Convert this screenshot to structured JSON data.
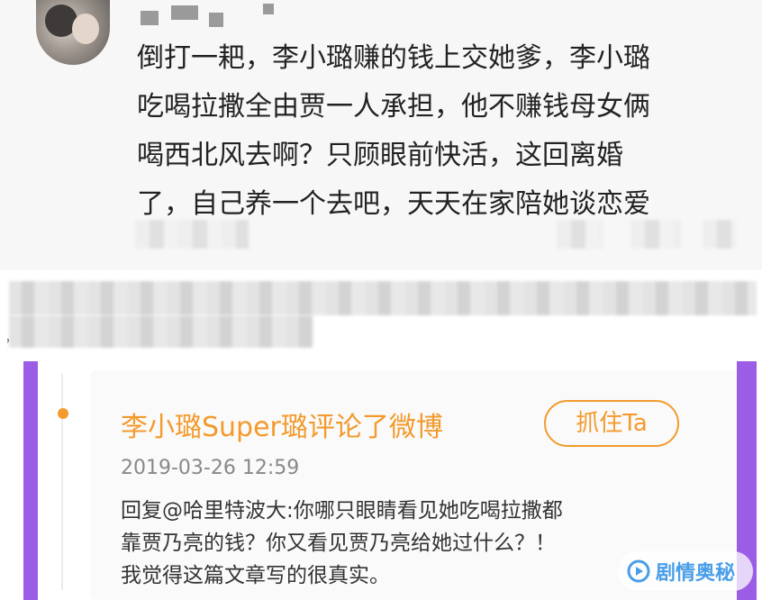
{
  "post": {
    "comment_lines": [
      "倒打一耙，李小璐赚的钱上交她爹，李小璐",
      "吃喝拉撒全由贾一人承担，他不赚钱母女俩",
      "喝西北风去啊？只顾眼前快活，这回离婚",
      "了，自己养一个去吧，天天在家陪她谈恋爱"
    ]
  },
  "separator_mark": "，",
  "reply_card": {
    "title": "李小璐Super璐评论了微博",
    "follow_button": "抓住Ta",
    "timestamp": "2019-03-26 12:59",
    "reply_lines": [
      "回复@哈里特波大:你哪只眼睛看见她吃喝拉撒都",
      "靠贾乃亮的钱？你又看见贾乃亮给她过什么？！",
      "我觉得这篇文章写的很真实。"
    ]
  },
  "watermark": {
    "text": "剧情奥秘",
    "icon": "play-swirl-icon"
  },
  "colors": {
    "accent_orange": "#f39a2c",
    "stripe_purple": "#9b5de5",
    "watermark_blue": "#4a9ee8"
  }
}
